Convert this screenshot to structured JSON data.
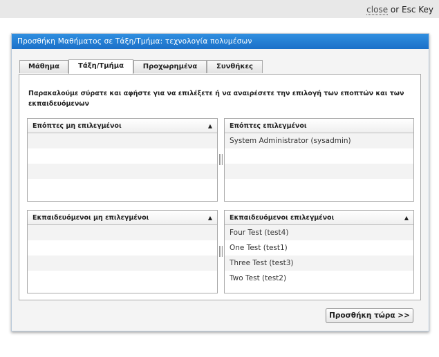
{
  "topbar": {
    "close_label": "close",
    "close_suffix": " or Esc Key"
  },
  "dialog": {
    "title": "Προσθήκη Μαθήματος σε Τάξη/Τμήμα: τεχνολογία πολυμέσων",
    "tabs": [
      {
        "label": "Μάθημα",
        "active": false
      },
      {
        "label": "Τάξη/Τμήμα",
        "active": true
      },
      {
        "label": "Προχωρημένα",
        "active": false
      },
      {
        "label": "Συνθήκες",
        "active": false
      }
    ],
    "instructions": "Παρακαλούμε σύρατε και αφήστε για να επιλέξετε ή να αναιρέσετε την επιλογή των εποπτών και των εκπαιδευόμενων",
    "lists": {
      "supervisors_unselected": {
        "header": "Επόπτες μη επιλεγμένοι",
        "sort_icon": "triangle-up",
        "items": []
      },
      "supervisors_selected": {
        "header": "Επόπτες επιλεγμένοι",
        "items": [
          "System Administrator (sysadmin)"
        ]
      },
      "learners_unselected": {
        "header": "Εκπαιδευόμενοι μη επιλεγμένοι",
        "sort_icon": "triangle-up",
        "items": []
      },
      "learners_selected": {
        "header": "Εκπαιδευόμενοι επιλεγμένοι",
        "sort_icon": "triangle-up",
        "items": [
          "Four Test (test4)",
          "One Test (test1)",
          "Three Test (test3)",
          "Two Test (test2)"
        ]
      }
    },
    "submit_label": "Προσθήκη τώρα >>"
  },
  "colors": {
    "header_blue": "#1b70c8",
    "panel_border": "#a9a9a9"
  }
}
